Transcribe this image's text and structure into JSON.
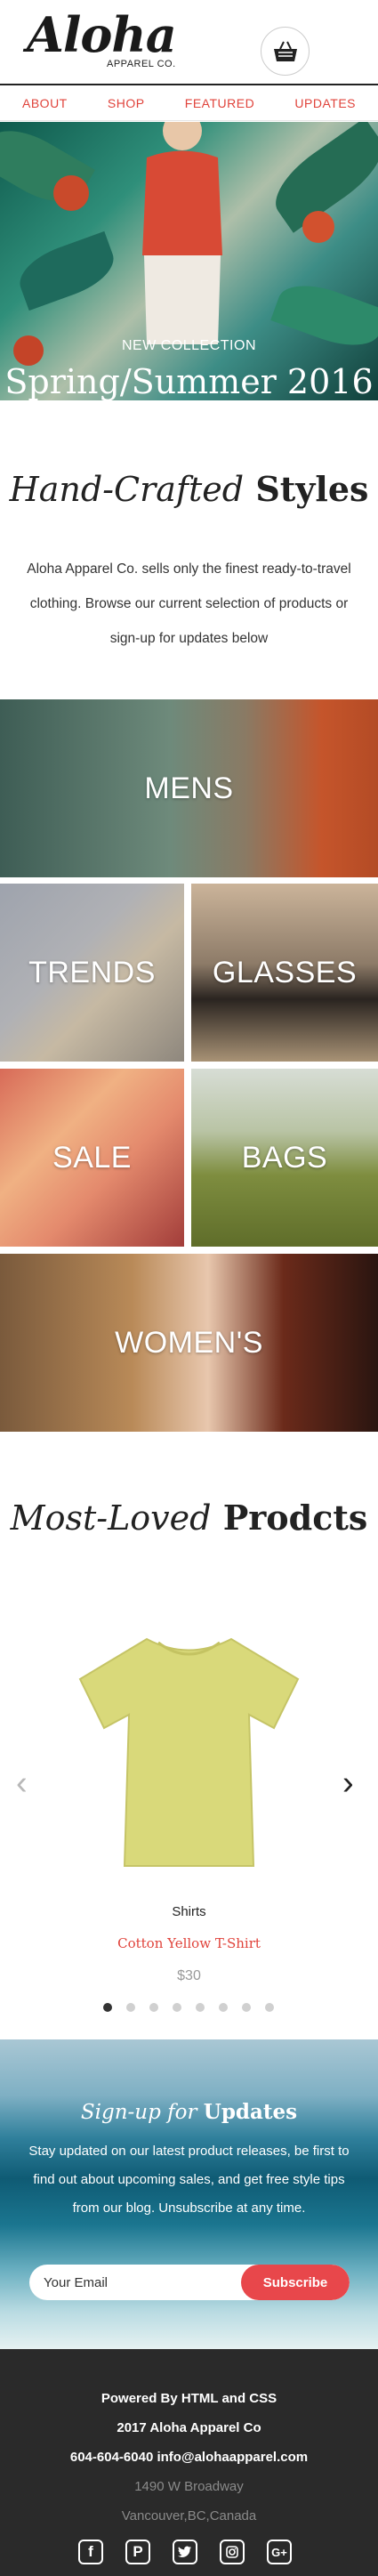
{
  "header": {
    "logo": "Aloha",
    "logo_sub": "APPAREL CO.",
    "cart_icon": "shopping-basket-icon"
  },
  "nav": {
    "items": [
      "ABOUT",
      "SHOP",
      "FEATURED",
      "UPDATES"
    ]
  },
  "hero": {
    "subtitle": "NEW COLLECTION",
    "title": "Spring/Summer 2016"
  },
  "styles": {
    "heading_italic": "Hand-Crafted",
    "heading_bold": "Styles",
    "intro": "Aloha Apparel Co. sells only the finest ready-to-travel clothing. Browse our current selection of products or sign-up for updates below"
  },
  "categories": [
    "MENS",
    "TRENDS",
    "GLASSES",
    "SALE",
    "BAGS",
    "WOMEN'S"
  ],
  "products": {
    "heading_italic": "Most-Loved",
    "heading_bold": "Prodcts",
    "item": {
      "category": "Shirts",
      "name": "Cotton Yellow T-Shirt",
      "price": "$30",
      "color": "#d9d97a"
    },
    "slide_count": 8,
    "active_slide": 1
  },
  "signup": {
    "title_italic": "Sign-up for",
    "title_bold": "Updates",
    "text": "Stay updated on our latest product releases, be first to find out about upcoming sales, and get free style tips from our blog. Unsubscribe at any time.",
    "email_placeholder": "Your Email",
    "button": "Subscribe"
  },
  "footer": {
    "powered": "Powered By HTML and CSS",
    "copyright": "2017 Aloha Apparel Co",
    "contact": "604-604-6040 info@alohaapparel.com",
    "address1": "1490 W Broadway",
    "address2": "Vancouver,BC,Canada",
    "socials": [
      "facebook-icon",
      "pinterest-icon",
      "twitter-icon",
      "instagram-icon",
      "google-plus-icon"
    ]
  },
  "colors": {
    "accent": "#e0433b",
    "button": "#e8474b",
    "footer_bg": "#2a2a2a"
  }
}
